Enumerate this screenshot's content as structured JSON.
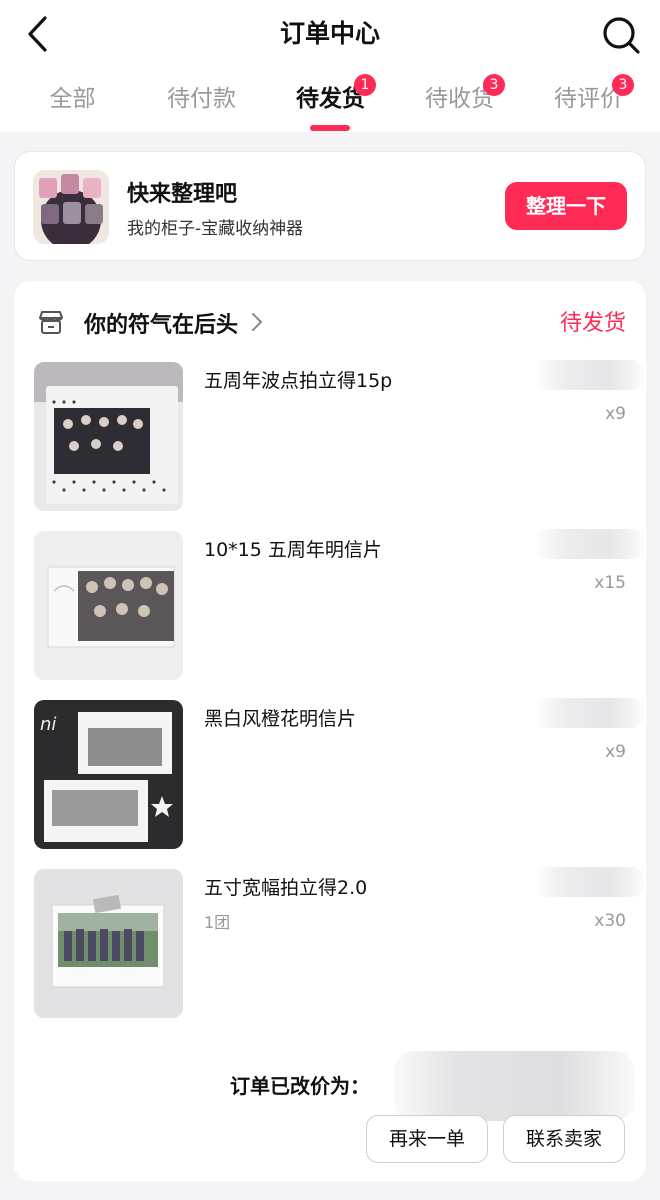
{
  "header": {
    "title": "订单中心",
    "back_icon": "chevron-left-icon",
    "search_icon": "search-icon"
  },
  "tabs": [
    {
      "label": "全部",
      "badge": "",
      "active": false
    },
    {
      "label": "待付款",
      "badge": "",
      "active": false
    },
    {
      "label": "待发货",
      "badge": "1",
      "active": true
    },
    {
      "label": "待收货",
      "badge": "3",
      "active": false
    },
    {
      "label": "待评价",
      "badge": "3",
      "active": false
    }
  ],
  "promo": {
    "title": "快来整理吧",
    "subtitle": "我的柜子-宝藏收纳神器",
    "button": "整理一下"
  },
  "order": {
    "store_name": "你的符气在后头",
    "status": "待发货",
    "items": [
      {
        "name": "五周年波点拍立得15p",
        "spec": "",
        "qty": "x9"
      },
      {
        "name": "10*15 五周年明信片",
        "spec": "",
        "qty": "x15"
      },
      {
        "name": "黑白风橙花明信片",
        "spec": "",
        "qty": "x9"
      },
      {
        "name": "五寸宽幅拍立得2.0",
        "spec": "1团",
        "qty": "x30"
      }
    ],
    "total_label": "订单已改价为：",
    "buttons": {
      "reorder": "再来一单",
      "contact": "联系卖家"
    }
  },
  "colors": {
    "accent": "#ff2a55",
    "page_bg": "#f4f4f6",
    "muted_text": "#999999"
  }
}
